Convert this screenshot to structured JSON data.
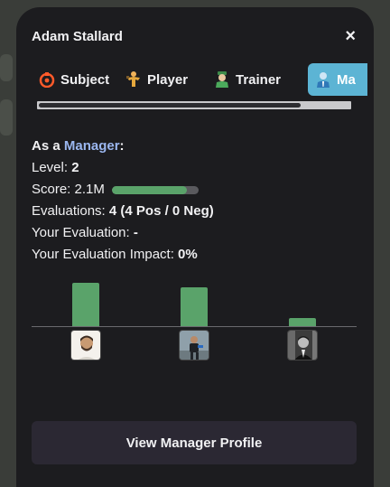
{
  "header": {
    "title": "Adam Stallard",
    "close_label": "×"
  },
  "tabs": [
    {
      "label": "Subject",
      "icon": "subject-icon"
    },
    {
      "label": "Player",
      "icon": "player-icon"
    },
    {
      "label": "Trainer",
      "icon": "trainer-icon"
    },
    {
      "label": "Ma",
      "icon": "manager-icon",
      "active": true
    }
  ],
  "stats": {
    "as_a_prefix": "As a",
    "role": "Manager",
    "role_suffix": ":",
    "level_label": "Level:",
    "level_value": "2",
    "score_label": "Score:",
    "score_value": "2.1M",
    "score_fill_fraction": 0.87,
    "evaluations_label": "Evaluations:",
    "evaluations_value": "4 (4 Pos / 0 Neg)",
    "your_evaluation_label": "Your Evaluation:",
    "your_evaluation_value": "-",
    "impact_label": "Your Evaluation Impact:",
    "impact_value": "0%"
  },
  "chart_data": {
    "type": "bar",
    "categories": [
      "avatar-1",
      "avatar-2",
      "avatar-3"
    ],
    "values": [
      46,
      41,
      9
    ],
    "ylim": [
      0,
      50
    ],
    "colors": {
      "bar": "#5aa36a"
    }
  },
  "footer": {
    "button_label": "View Manager Profile"
  }
}
